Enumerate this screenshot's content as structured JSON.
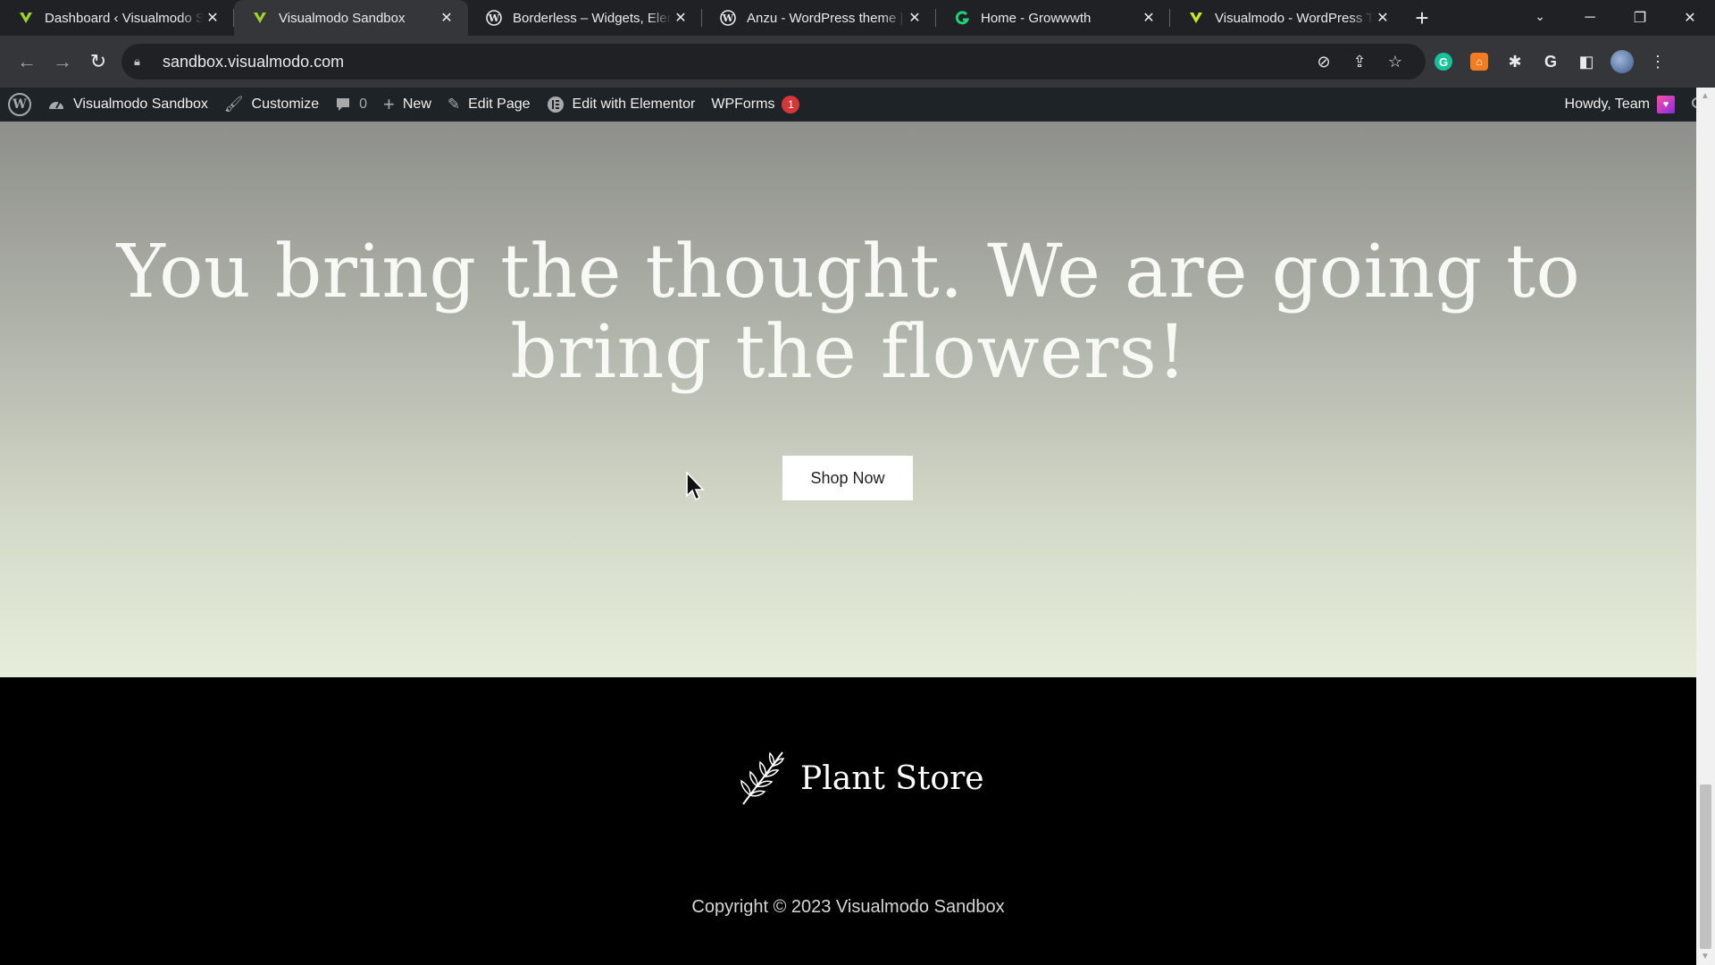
{
  "browser": {
    "tabs": [
      {
        "title": "Dashboard ‹ Visualmodo Sandbox",
        "favicon": "visualmodo-v-icon",
        "active": false
      },
      {
        "title": "Visualmodo Sandbox",
        "favicon": "visualmodo-v-icon",
        "active": true
      },
      {
        "title": "Borderless – Widgets, Elementor",
        "favicon": "wordpress-icon",
        "active": false
      },
      {
        "title": "Anzu - WordPress theme | Visualmodo",
        "favicon": "wordpress-icon",
        "active": false
      },
      {
        "title": "Home - Growwwth",
        "favicon": "growwwth-icon",
        "active": false
      },
      {
        "title": "Visualmodo - WordPress Themes",
        "favicon": "visualmodo-v-icon",
        "active": false
      }
    ],
    "new_tab_glyph": "+",
    "address": "sandbox.visualmodo.com"
  },
  "adminbar": {
    "site": "Visualmodo Sandbox",
    "customize": "Customize",
    "comments_count": "0",
    "new": "New",
    "edit_page": "Edit Page",
    "elementor": "Edit with Elementor",
    "wpforms": "WPForms",
    "wpforms_badge": "1",
    "howdy": "Howdy, Team"
  },
  "hero": {
    "headline": "You bring the thought. We are going to bring the flowers!",
    "cta": "Shop Now"
  },
  "footer": {
    "brand": "Plant Store",
    "copyright": "Copyright © 2023 Visualmodo Sandbox"
  },
  "colors": {
    "chrome_dark": "#202124",
    "adminbar": "#1d2327",
    "badge": "#d63638"
  }
}
